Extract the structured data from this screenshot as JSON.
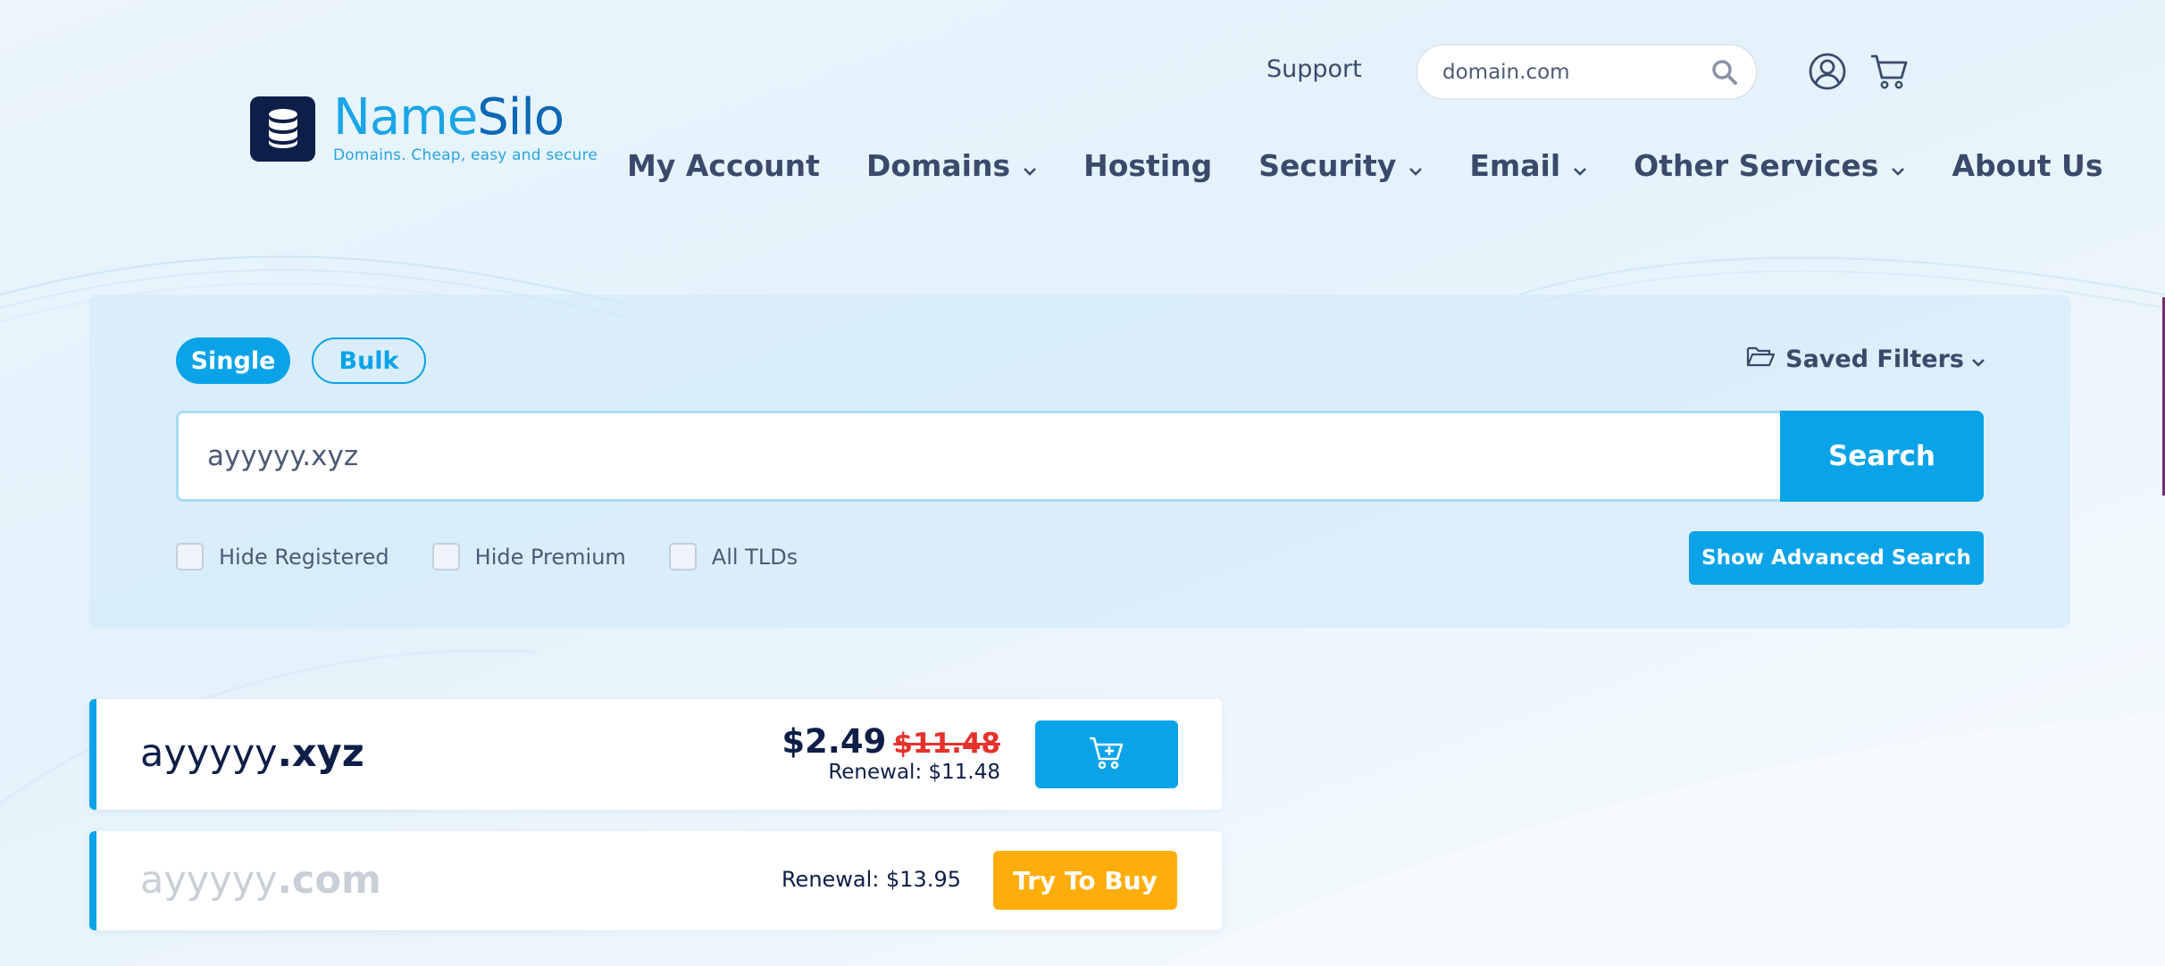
{
  "brand": {
    "name_part1": "Name",
    "name_part2": "Silo",
    "tagline": "Domains. Cheap, easy and secure"
  },
  "header": {
    "support_label": "Support",
    "search_placeholder": "domain.com"
  },
  "nav": {
    "items": [
      {
        "label": "My Account",
        "dropdown": false
      },
      {
        "label": "Domains",
        "dropdown": true
      },
      {
        "label": "Hosting",
        "dropdown": false
      },
      {
        "label": "Security",
        "dropdown": true
      },
      {
        "label": "Email",
        "dropdown": true
      },
      {
        "label": "Other Services",
        "dropdown": true
      },
      {
        "label": "About Us",
        "dropdown": false
      }
    ]
  },
  "search_panel": {
    "mode_single": "Single",
    "mode_bulk": "Bulk",
    "active_mode": "Single",
    "saved_filters_label": "Saved Filters",
    "query_value": "ayyyyy.xyz",
    "search_button": "Search",
    "filters": [
      {
        "label": "Hide Registered",
        "checked": false
      },
      {
        "label": "Hide Premium",
        "checked": false
      },
      {
        "label": "All TLDs",
        "checked": false
      }
    ],
    "advanced_button": "Show Advanced Search"
  },
  "results": [
    {
      "sld": "ayyyyy",
      "tld": ".xyz",
      "price": "$2.49",
      "old_price": "$11.48",
      "renewal": "Renewal: $11.48",
      "available": true,
      "action_icon": "add-to-cart-icon"
    },
    {
      "sld": "ayyyyy",
      "tld": ".com",
      "renewal": "Renewal: $13.95",
      "available": false,
      "action_label": "Try To Buy"
    }
  ],
  "colors": {
    "accent": "#0aa3e8",
    "navy": "#0d1f48",
    "nav_text": "#3b4a6b",
    "sale_red": "#e5322c",
    "try_orange": "#ffad0a"
  }
}
